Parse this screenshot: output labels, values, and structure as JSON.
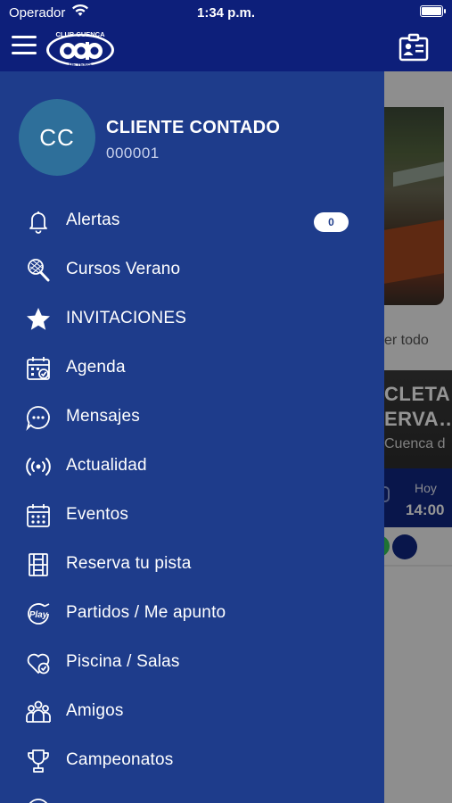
{
  "status_bar": {
    "carrier": "Operador",
    "time": "1:34 p.m."
  },
  "header": {
    "logo_text_top": "CLUB CUENCA",
    "logo_text_bottom": "DE TENIS"
  },
  "user": {
    "initials": "CC",
    "name": "CLIENTE CONTADO",
    "id": "000001"
  },
  "menu": [
    {
      "label": "Alertas",
      "icon": "bell-icon",
      "badge": "0"
    },
    {
      "label": "Cursos Verano",
      "icon": "tennis-racket-icon"
    },
    {
      "label": "INVITACIONES",
      "icon": "star-icon"
    },
    {
      "label": "Agenda",
      "icon": "calendar-check-icon"
    },
    {
      "label": "Mensajes",
      "icon": "chat-bubble-icon"
    },
    {
      "label": "Actualidad",
      "icon": "broadcast-icon"
    },
    {
      "label": "Eventos",
      "icon": "calendar-grid-icon"
    },
    {
      "label": "Reserva tu pista",
      "icon": "court-icon"
    },
    {
      "label": "Partidos / Me apunto",
      "icon": "play-icon"
    },
    {
      "label": "Piscina / Salas",
      "icon": "heart-check-icon"
    },
    {
      "label": "Amigos",
      "icon": "group-icon"
    },
    {
      "label": "Campeonatos",
      "icon": "trophy-icon"
    }
  ],
  "background": {
    "see_all": "er todo",
    "news_line1": "CLETA",
    "news_line2": "ERVA…",
    "news_line3": "Cuenca d",
    "slot_day": "Hoy",
    "slot_time": "14:00"
  },
  "colors": {
    "header": "#0d1f7a",
    "drawer": "#1e3c8b",
    "avatar": "#2e6f9a"
  }
}
